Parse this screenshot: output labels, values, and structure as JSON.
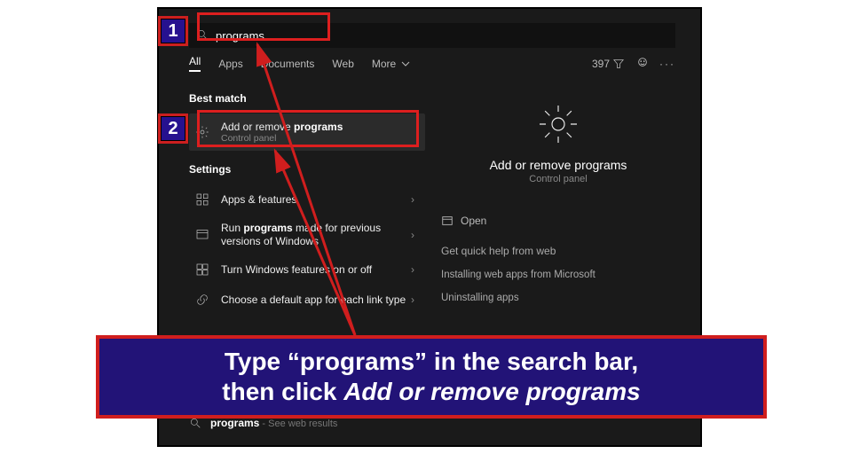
{
  "search": {
    "value": "programs"
  },
  "tabs": {
    "items": [
      "All",
      "Apps",
      "Documents",
      "Web"
    ],
    "more": "More",
    "countLabel": "397"
  },
  "left": {
    "bestMatchLabel": "Best match",
    "best": {
      "titlePrefix": "Add or remove ",
      "titleBold": "programs",
      "sub": "Control panel"
    },
    "settingsLabel": "Settings",
    "items": [
      {
        "titlePrefix": "Apps & features",
        "titleBold": "",
        "sub": ""
      },
      {
        "titlePrefix": "Run ",
        "titleBold": "programs",
        "titleSuffix": " made for previous versions of Windows",
        "sub": ""
      },
      {
        "titlePrefix": "Turn Windows features on or off",
        "titleBold": "",
        "sub": ""
      },
      {
        "titlePrefix": "Choose a default app for each link type",
        "titleBold": "",
        "sub": ""
      }
    ]
  },
  "preview": {
    "title": "Add or remove programs",
    "sub": "Control panel",
    "open": "Open",
    "quickHeader": "Get quick help from web",
    "quickItems": [
      "Installing web apps from Microsoft",
      "Uninstalling apps"
    ]
  },
  "web": {
    "bold": "programs",
    "suffix": " - See web results"
  },
  "annot": {
    "badge1": "1",
    "badge2": "2",
    "caption_pre": "Type “programs” in the search bar,\nthen click ",
    "caption_em": "Add or remove programs"
  }
}
